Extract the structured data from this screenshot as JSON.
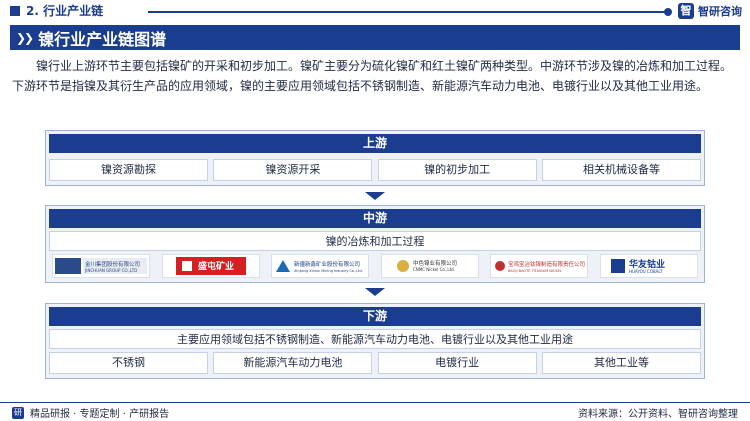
{
  "header": {
    "section": "2. 行业产业链",
    "brand": "智研咨询",
    "brand_icon": "zhiyan-logo-icon"
  },
  "banner": {
    "title": "镍行业产业链图谱",
    "icon": "double-chevron-icon"
  },
  "intro": "镍行业上游环节主要包括镍矿的开采和初步加工。镍矿主要分为硫化镍矿和红土镍矿两种类型。中游环节涉及镍的冶炼和加工过程。下游环节是指镍及其衍生产品的应用领域，镍的主要应用领域包括不锈钢制造、新能源汽车动力电池、电镀行业以及其他工业用途。",
  "upstream": {
    "title": "上游",
    "items": [
      "镍资源勘探",
      "镍资源开采",
      "镍的初步加工",
      "相关机械设备等"
    ]
  },
  "midstream": {
    "title": "中游",
    "subtitle": "镍的冶炼和加工过程",
    "logos": [
      {
        "name": "金川集团股份有限公司",
        "sub": "JINCHUAN GROUP CO.,LTD",
        "color": "#2a4a8a"
      },
      {
        "name": "盛屯矿业",
        "sub": "SHENGTUN MINING",
        "color": "#d42020"
      },
      {
        "name": "新疆新鑫矿业股份有限公司",
        "sub": "Xinjiang Xinxin Mining Industry Co., Ltd.",
        "color": "#1a6ab8"
      },
      {
        "name": "中色镍业有限公司",
        "sub": "CNMC Nickel Co., Ltd.",
        "color": "#8a6a20"
      },
      {
        "name": "宝鸡钛业",
        "sub": "BAOJI BAOTE TITANIUM",
        "color": "#c03030"
      },
      {
        "name": "华友钴业",
        "sub": "HUAYOU COBALT",
        "color": "#1a3d8f"
      }
    ]
  },
  "downstream": {
    "title": "下游",
    "subtitle": "主要应用领域包括不锈钢制造、新能源汽车动力电池、电镀行业以及其他工业用途",
    "items": [
      "不锈钢",
      "新能源汽车动力电池",
      "电镀行业",
      "其他工业等"
    ]
  },
  "footer": {
    "left": "精品研报 · 专题定制 · 产研报告",
    "right": "资料来源：公开资料、智研咨询整理"
  }
}
